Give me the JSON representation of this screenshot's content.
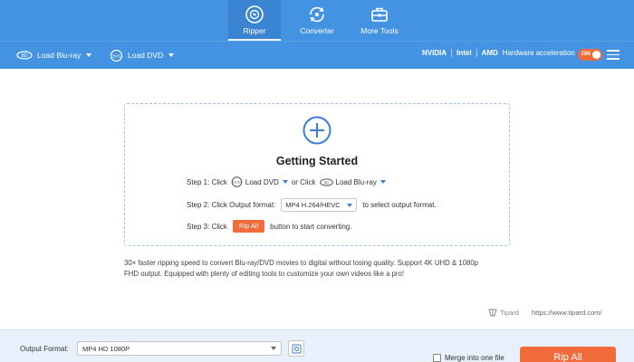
{
  "nav": {
    "tabs": [
      {
        "label": "Ripper",
        "icon": "ripper-disc-icon",
        "active": true
      },
      {
        "label": "Converter",
        "icon": "converter-refresh-icon",
        "active": false
      },
      {
        "label": "More Tools",
        "icon": "toolbox-icon",
        "active": false
      }
    ]
  },
  "toolbar": {
    "load_bluray": "Load Blu-ray",
    "load_dvd": "Load DVD",
    "hw_nvidia": "NVIDIA",
    "hw_intel": "Intel",
    "hw_amd": "AMD",
    "hw_label": "Hardware acceleration",
    "toggle_state": "ON"
  },
  "getting_started": {
    "title": "Getting Started",
    "step1_prefix": "Step 1: Click",
    "step1_dvd": "Load DVD",
    "step1_or": "or Click",
    "step1_bluray": "Load Blu-ray",
    "step2_prefix": "Step 2: Click Output format:",
    "step2_format": "MP4 H.264/HEVC",
    "step2_suffix": "to select output format.",
    "step3_prefix": "Step 3: Click",
    "step3_button": "Rip All",
    "step3_suffix": "button to start converting."
  },
  "description": {
    "line1": "30× faster ripping speed to convert  Blu-ray/DVD movies to digital without losing quality. Support 4K UHD & 1080p",
    "line2": "FHD output. Equipped with plenty of editing tools to customize your own videos like a pro!"
  },
  "brand": {
    "name": "Tipard",
    "url": "https://www.tipard.com/"
  },
  "bottom": {
    "output_format_label": "Output Format:",
    "output_format_value": "MP4 HD 1080P",
    "merge_label": "Merge into one file",
    "rip_all_label": "Rip All"
  },
  "colors": {
    "accent_blue": "#4493e2",
    "accent_orange": "#f26b3a",
    "bottom_bar": "#e7f0fb"
  }
}
